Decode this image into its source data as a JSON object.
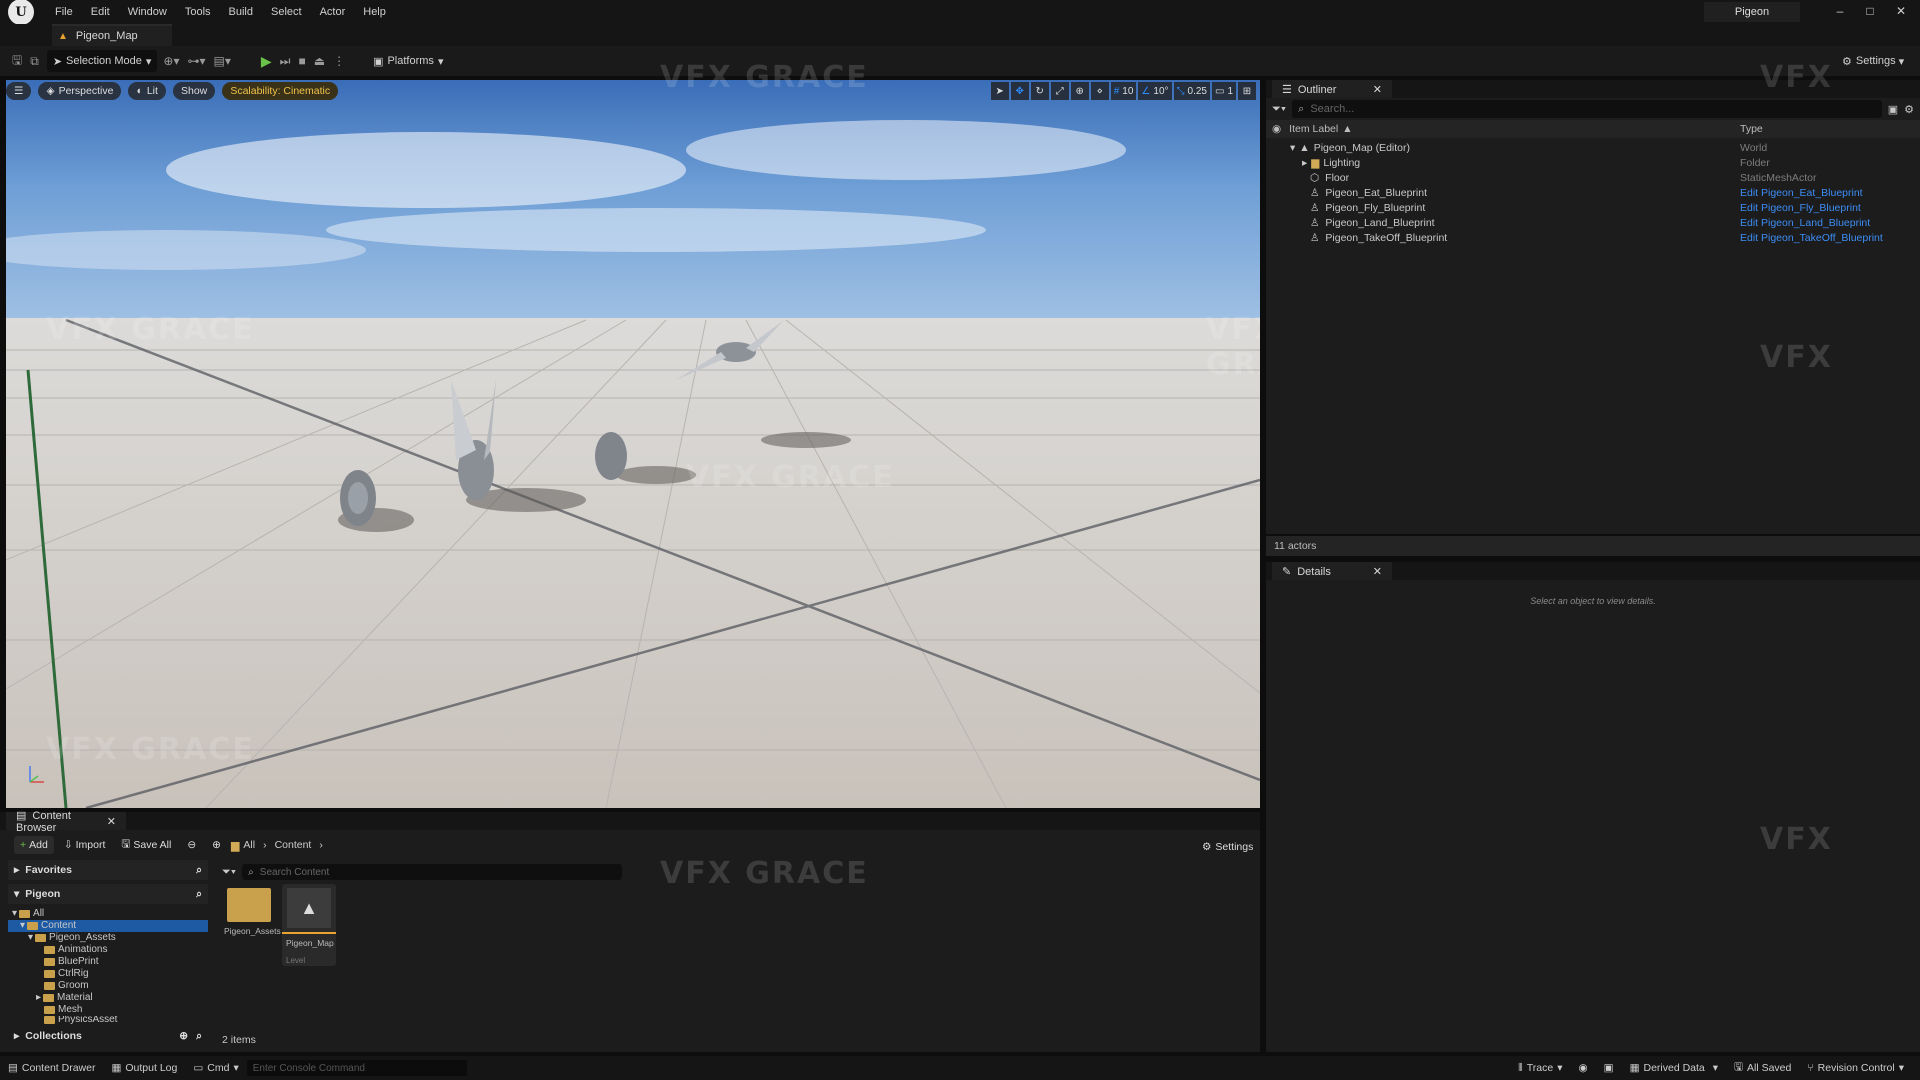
{
  "menu": {
    "items": [
      "File",
      "Edit",
      "Window",
      "Tools",
      "Build",
      "Select",
      "Actor",
      "Help"
    ]
  },
  "tab": {
    "map_name": "Pigeon_Map"
  },
  "project": {
    "name": "Pigeon"
  },
  "toolbar": {
    "mode_label": "Selection Mode",
    "platforms_label": "Platforms",
    "settings_label": "Settings"
  },
  "viewport": {
    "perspective": "Perspective",
    "lit": "Lit",
    "show": "Show",
    "scalability": "Scalability: Cinematic",
    "grid_snap": "10",
    "rot_snap": "10°",
    "scale_snap": "0.25",
    "camera_speed": "1"
  },
  "outliner": {
    "title": "Outliner",
    "search_placeholder": "Search...",
    "col_label": "Item Label",
    "col_type": "Type",
    "rows": [
      {
        "label": "Pigeon_Map (Editor)",
        "type": "World"
      },
      {
        "label": "Lighting",
        "type": "Folder"
      },
      {
        "label": "Floor",
        "type": "StaticMeshActor"
      },
      {
        "label": "Pigeon_Eat_Blueprint",
        "type": "Edit Pigeon_Eat_Blueprint"
      },
      {
        "label": "Pigeon_Fly_Blueprint",
        "type": "Edit Pigeon_Fly_Blueprint"
      },
      {
        "label": "Pigeon_Land_Blueprint",
        "type": "Edit Pigeon_Land_Blueprint"
      },
      {
        "label": "Pigeon_TakeOff_Blueprint",
        "type": "Edit Pigeon_TakeOff_Blueprint"
      }
    ],
    "actor_count": "11 actors"
  },
  "details": {
    "title": "Details",
    "empty_msg": "Select an object to view details."
  },
  "content_browser": {
    "title": "Content Browser",
    "add": "Add",
    "import": "Import",
    "save_all": "Save All",
    "crumb_all": "All",
    "crumb_content": "Content",
    "settings": "Settings",
    "search_placeholder": "Search Content",
    "favorites": "Favorites",
    "project": "Pigeon",
    "collections": "Collections",
    "tree": [
      "All",
      "Content",
      "Pigeon_Assets",
      "Animations",
      "BluePrint",
      "CtrlRig",
      "Groom",
      "Material",
      "Mesh",
      "PhysicsAsset"
    ],
    "assets": [
      {
        "name": "Pigeon_Assets"
      },
      {
        "name": "Pigeon_Map",
        "type": "Level"
      }
    ],
    "item_count": "2 items"
  },
  "status": {
    "content_drawer": "Content Drawer",
    "output_log": "Output Log",
    "cmd": "Cmd",
    "console_placeholder": "Enter Console Command",
    "trace": "Trace",
    "derived_data": "Derived Data",
    "all_saved": "All Saved",
    "revision_control": "Revision Control"
  },
  "watermark": {
    "text": "VFX GRACE",
    "short": "VFX"
  }
}
